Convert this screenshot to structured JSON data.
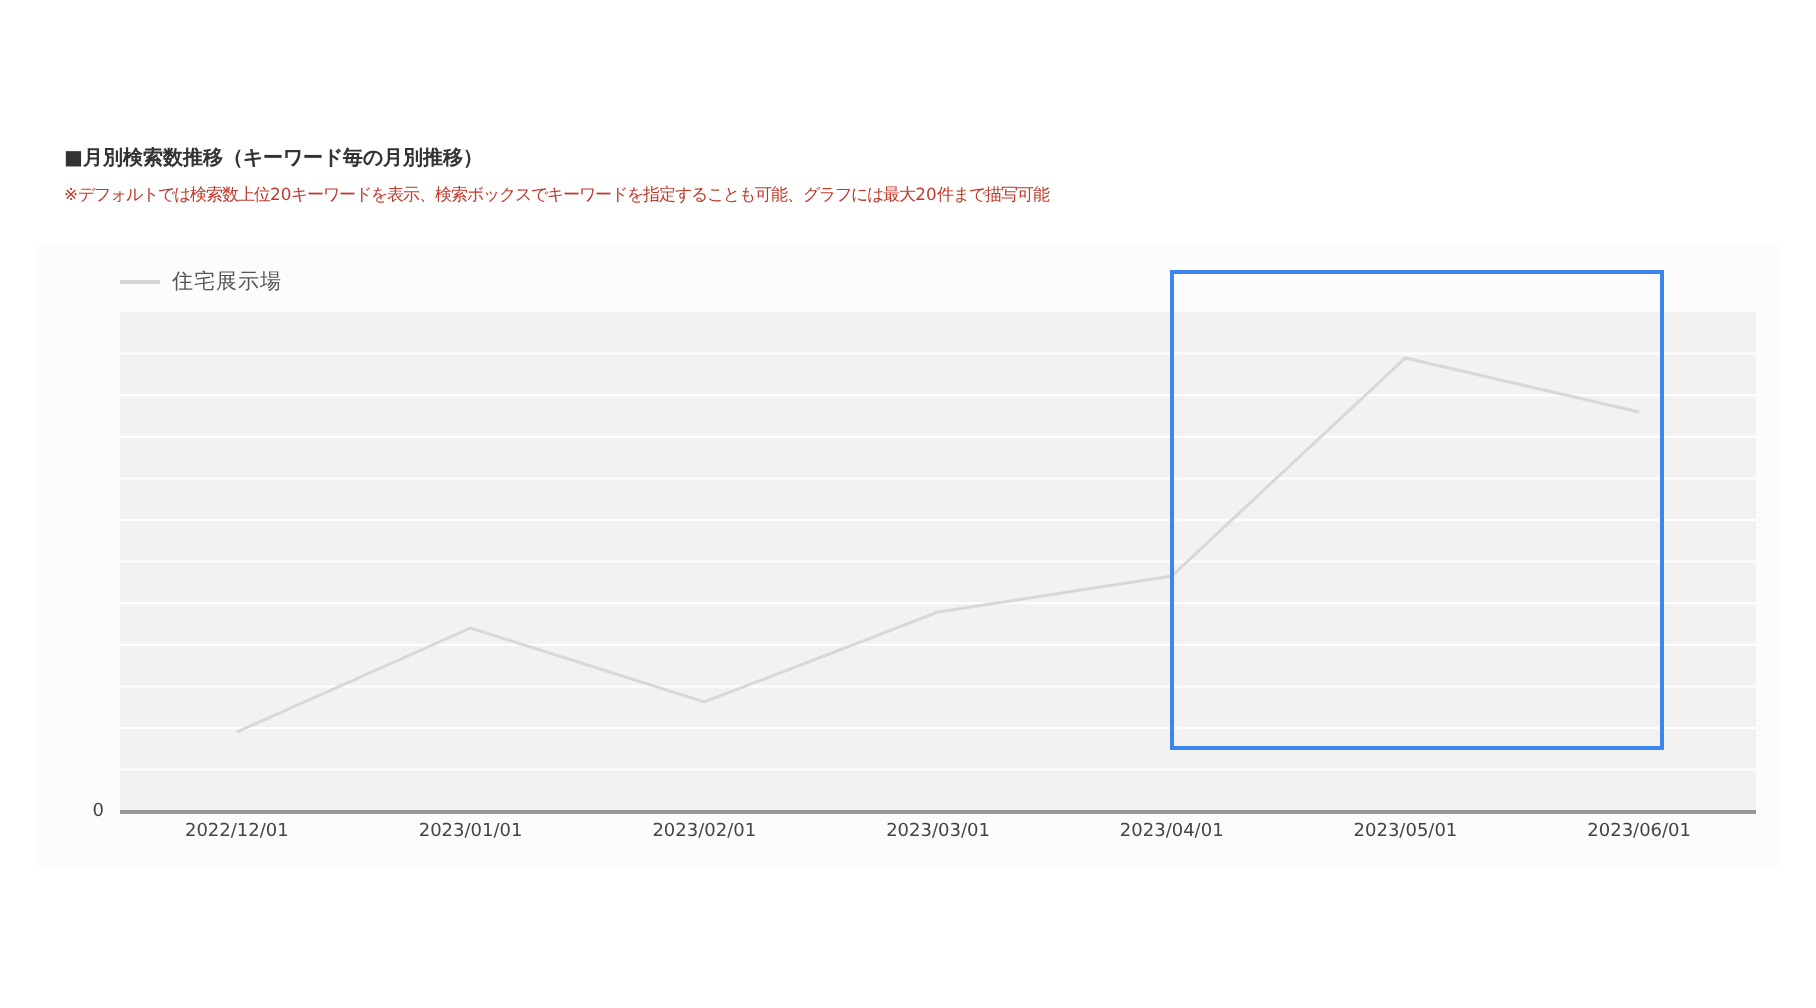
{
  "heading": "■月別検索数推移（キーワード毎の月別推移）",
  "note": "※デフォルトでは検索数上位20キーワードを表示、検索ボックスでキーワードを指定することも可能、グラフには最大20件まで描写可能",
  "chart": {
    "legend": "住宅展示場",
    "y_axis_label": "0",
    "x_labels": [
      "2022/12/01",
      "2023/01/01",
      "2023/02/01",
      "2023/03/01",
      "2023/04/01",
      "2023/05/01",
      "2023/06/01"
    ],
    "highlight": true
  }
}
